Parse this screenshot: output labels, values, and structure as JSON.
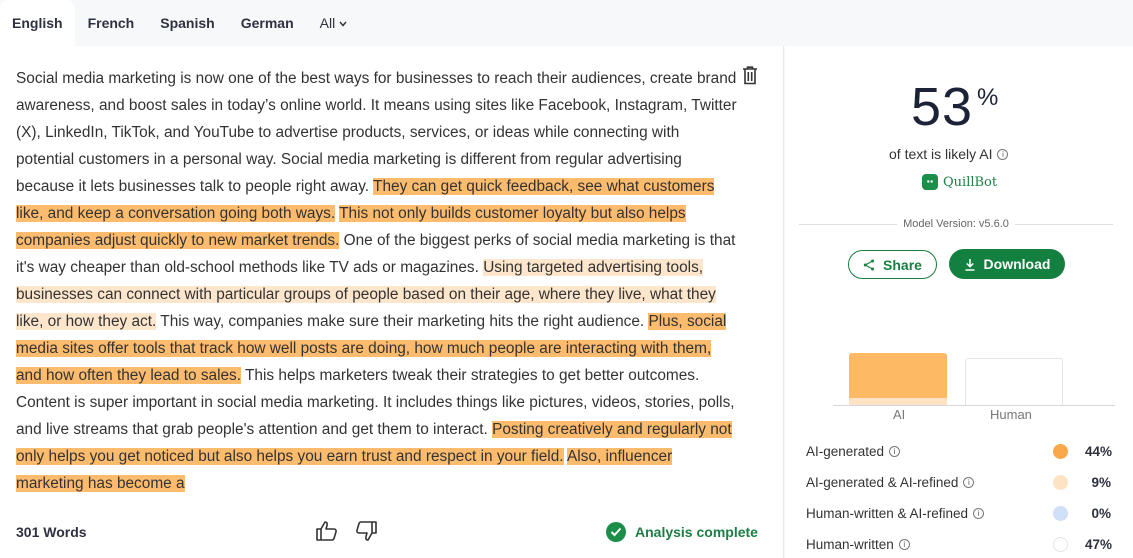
{
  "tabs": [
    {
      "label": "English",
      "active": true
    },
    {
      "label": "French"
    },
    {
      "label": "Spanish"
    },
    {
      "label": "German"
    },
    {
      "label": "All"
    }
  ],
  "text_segments": [
    {
      "text": "Social media marketing is now one of the best ways for businesses to reach their audiences, create brand awareness, and boost sales in today’s online world. It means using sites like Facebook, Instagram, Twitter (X), LinkedIn, TikTok, and YouTube to advertise products, services, or ideas while connecting with potential customers in a personal way. Social media marketing is different from regular advertising because it lets businesses talk to people right away. ",
      "hl": "none"
    },
    {
      "text": "They can get quick feedback, see what customers like, and keep a conversation going both ways.",
      "hl": "ai"
    },
    {
      "text": " ",
      "hl": "none"
    },
    {
      "text": "This not only builds customer loyalty but also helps companies adjust quickly to new market trends.",
      "hl": "ai"
    },
    {
      "text": " One of the biggest perks of social media marketing is that it's way cheaper than old-school methods like TV ads or magazines. ",
      "hl": "none"
    },
    {
      "text": "Using targeted advertising tools, businesses can connect with particular groups of people based on their age, where they live, what they like, or how they act.",
      "hl": "refined"
    },
    {
      "text": " This way, companies make sure their marketing hits the right audience. ",
      "hl": "none"
    },
    {
      "text": "Plus, social media sites offer tools that track how well posts are doing, how much people are interacting with them, and how often they lead to sales.",
      "hl": "ai"
    },
    {
      "text": " This helps marketers tweak their strategies to get better outcomes. Content is super important in social media marketing. It includes things like pictures, videos, stories, polls, and live streams that grab people's attention and get them to interact. ",
      "hl": "none"
    },
    {
      "text": "Posting creatively and regularly not only helps you get noticed but also helps you earn trust and respect in your field.",
      "hl": "ai"
    },
    {
      "text": " ",
      "hl": "none"
    },
    {
      "text": "Also, influencer marketing has become a",
      "hl": "ai"
    }
  ],
  "footer": {
    "word_count": "301 Words",
    "status": "Analysis complete"
  },
  "result": {
    "percent": "53",
    "percent_sign": "%",
    "likely_label": "of text is likely AI",
    "brand": "QuillBot",
    "model_version": "Model Version: v5.6.0",
    "share_label": "Share",
    "download_label": "Download"
  },
  "chart_data": {
    "type": "bar",
    "categories": [
      "AI",
      "Human"
    ],
    "values": [
      53,
      47
    ]
  },
  "breakdown": [
    {
      "label": "AI-generated",
      "value": "44%",
      "color": "#f9a94b"
    },
    {
      "label": "AI-generated & AI-refined",
      "value": "9%",
      "color": "#fde3c4"
    },
    {
      "label": "Human-written & AI-refined",
      "value": "0%",
      "color": "#cfe0f7"
    },
    {
      "label": "Human-written",
      "value": "47%",
      "color": "#ffffff"
    }
  ],
  "colors": {
    "ai_highlight": "#fdbb6d",
    "refined_highlight": "#fde6cc",
    "brand_green": "#14803f"
  }
}
